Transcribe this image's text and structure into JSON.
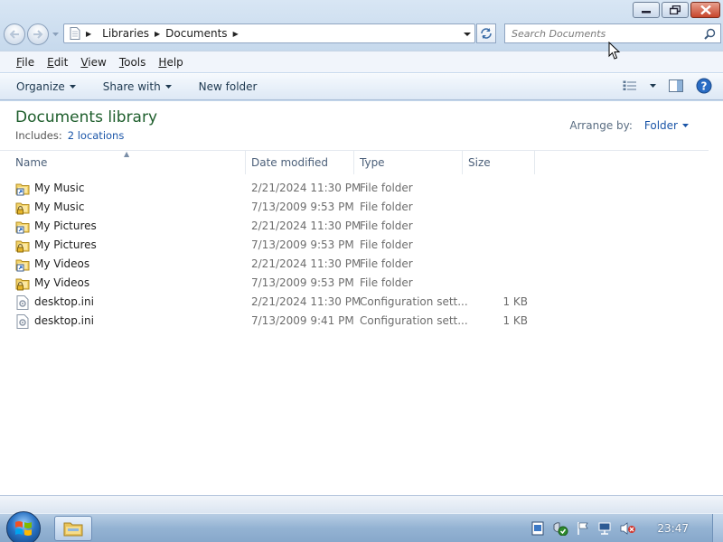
{
  "window": {
    "caption_buttons": [
      "minimize-icon",
      "restore-icon",
      "close-icon"
    ]
  },
  "address": {
    "crumbs": [
      "Libraries",
      "Documents"
    ]
  },
  "search": {
    "placeholder": "Search Documents"
  },
  "menu": {
    "items": [
      {
        "label": "File",
        "accel": "F",
        "rest": "ile"
      },
      {
        "label": "Edit",
        "accel": "E",
        "rest": "dit"
      },
      {
        "label": "View",
        "accel": "V",
        "rest": "iew"
      },
      {
        "label": "Tools",
        "accel": "T",
        "rest": "ools"
      },
      {
        "label": "Help",
        "accel": "H",
        "rest": "elp"
      }
    ]
  },
  "toolbar": {
    "organize": "Organize",
    "share_with": "Share with",
    "new_folder": "New folder"
  },
  "library": {
    "title": "Documents library",
    "includes_label": "Includes:",
    "includes_link": "2 locations",
    "arrange_label": "Arrange by:",
    "arrange_value": "Folder"
  },
  "columns": {
    "name": "Name",
    "date": "Date modified",
    "type": "Type",
    "size": "Size"
  },
  "files": [
    {
      "name": "My Music",
      "date": "2/21/2024 11:30 PM",
      "type": "File folder",
      "size": "",
      "icon": "shortcut-folder-icon"
    },
    {
      "name": "My Music",
      "date": "7/13/2009 9:53 PM",
      "type": "File folder",
      "size": "",
      "icon": "locked-folder-icon"
    },
    {
      "name": "My Pictures",
      "date": "2/21/2024 11:30 PM",
      "type": "File folder",
      "size": "",
      "icon": "shortcut-folder-icon"
    },
    {
      "name": "My Pictures",
      "date": "7/13/2009 9:53 PM",
      "type": "File folder",
      "size": "",
      "icon": "locked-folder-icon"
    },
    {
      "name": "My Videos",
      "date": "2/21/2024 11:30 PM",
      "type": "File folder",
      "size": "",
      "icon": "shortcut-folder-icon"
    },
    {
      "name": "My Videos",
      "date": "7/13/2009 9:53 PM",
      "type": "File folder",
      "size": "",
      "icon": "locked-folder-icon"
    },
    {
      "name": "desktop.ini",
      "date": "2/21/2024 11:30 PM",
      "type": "Configuration sett...",
      "size": "1 KB",
      "icon": "settings-file-icon"
    },
    {
      "name": "desktop.ini",
      "date": "7/13/2009 9:41 PM",
      "type": "Configuration sett...",
      "size": "1 KB",
      "icon": "settings-file-icon"
    }
  ],
  "taskbar": {
    "clock": "23:47",
    "tray_icons": [
      "action-center-icon",
      "security-shield-icon",
      "flag-icon",
      "network-icon",
      "volume-muted-icon"
    ]
  },
  "colors": {
    "library_title": "#1e5e2c",
    "link": "#1a55a8",
    "close_button": "#c7452c"
  }
}
